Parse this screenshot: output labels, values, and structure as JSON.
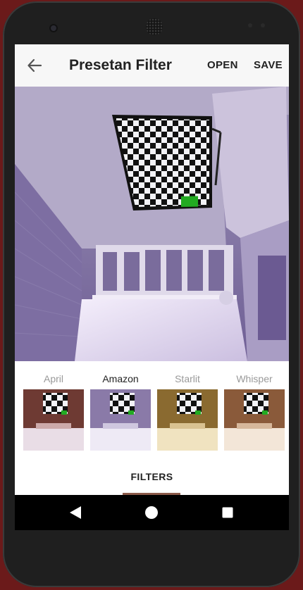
{
  "appbar": {
    "title": "Presetan Filter",
    "open_label": "OPEN",
    "save_label": "SAVE",
    "back_icon": "arrow-left-icon"
  },
  "filters": [
    {
      "label": "April",
      "selected": false,
      "tint": "#7a3a2a"
    },
    {
      "label": "Amazon",
      "selected": true,
      "tint": "#7b6b9e"
    },
    {
      "label": "Starlit",
      "selected": false,
      "tint": "#8a6a30"
    },
    {
      "label": "Whisper",
      "selected": false,
      "tint": "#8a5a3a"
    }
  ],
  "tabs": {
    "filters_label": "FILTERS"
  },
  "navbar": {
    "back_icon": "triangle-back-icon",
    "home_icon": "circle-home-icon",
    "recent_icon": "square-recents-icon"
  },
  "colors": {
    "photo_base": "#8a7aa8",
    "checkerboard_highlight": "#22aa22",
    "tab_indicator": "#8b5a4a"
  }
}
